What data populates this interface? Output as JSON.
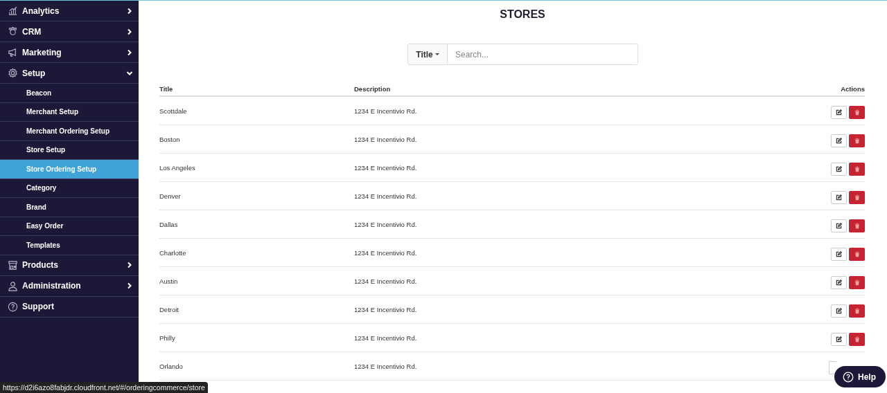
{
  "sidebar": {
    "items": [
      {
        "label": "Analytics",
        "kind": "group",
        "expanded": false
      },
      {
        "label": "CRM",
        "kind": "group",
        "expanded": false
      },
      {
        "label": "Marketing",
        "kind": "group",
        "expanded": false
      },
      {
        "label": "Setup",
        "kind": "group",
        "expanded": true,
        "children": [
          {
            "label": "Beacon",
            "selected": false
          },
          {
            "label": "Merchant Setup",
            "selected": false
          },
          {
            "label": "Merchant Ordering Setup",
            "selected": false
          },
          {
            "label": "Store Setup",
            "selected": false
          },
          {
            "label": "Store Ordering Setup",
            "selected": true
          },
          {
            "label": "Category",
            "selected": false
          },
          {
            "label": "Brand",
            "selected": false
          },
          {
            "label": "Easy Order",
            "selected": false
          },
          {
            "label": "Templates",
            "selected": false
          }
        ]
      },
      {
        "label": "Products",
        "kind": "group",
        "expanded": false
      },
      {
        "label": "Administration",
        "kind": "group",
        "expanded": false
      },
      {
        "label": "Support",
        "kind": "link"
      }
    ]
  },
  "page": {
    "title": "STORES"
  },
  "search": {
    "filter": "Title",
    "placeholder": "Search..."
  },
  "table": {
    "columns": [
      "Title",
      "Description",
      "Actions"
    ],
    "rows": [
      {
        "title": "Scottdale",
        "description": "1234 E Incentivio Rd."
      },
      {
        "title": "Boston",
        "description": "1234 E Incentivio Rd."
      },
      {
        "title": "Los Angeles",
        "description": "1234 E Incentivio Rd."
      },
      {
        "title": "Denver",
        "description": "1234 E Incentivio Rd."
      },
      {
        "title": "Dallas",
        "description": "1234 E Incentivio Rd."
      },
      {
        "title": "Charlotte",
        "description": "1234 E Incentivio Rd."
      },
      {
        "title": "Austin",
        "description": "1234 E Incentivio Rd."
      },
      {
        "title": "Detroit",
        "description": "1234 E Incentivio Rd."
      },
      {
        "title": "Philly",
        "description": "1234 E Incentivio Rd."
      },
      {
        "title": "Orlando",
        "description": "1234 E Incentivio Rd.",
        "covered": true
      }
    ]
  },
  "status_bar": {
    "url": "https://d2i6azo8fabjdr.cloudfront.net/#/orderingcommerce/store"
  },
  "help_button": {
    "label": "Help"
  }
}
